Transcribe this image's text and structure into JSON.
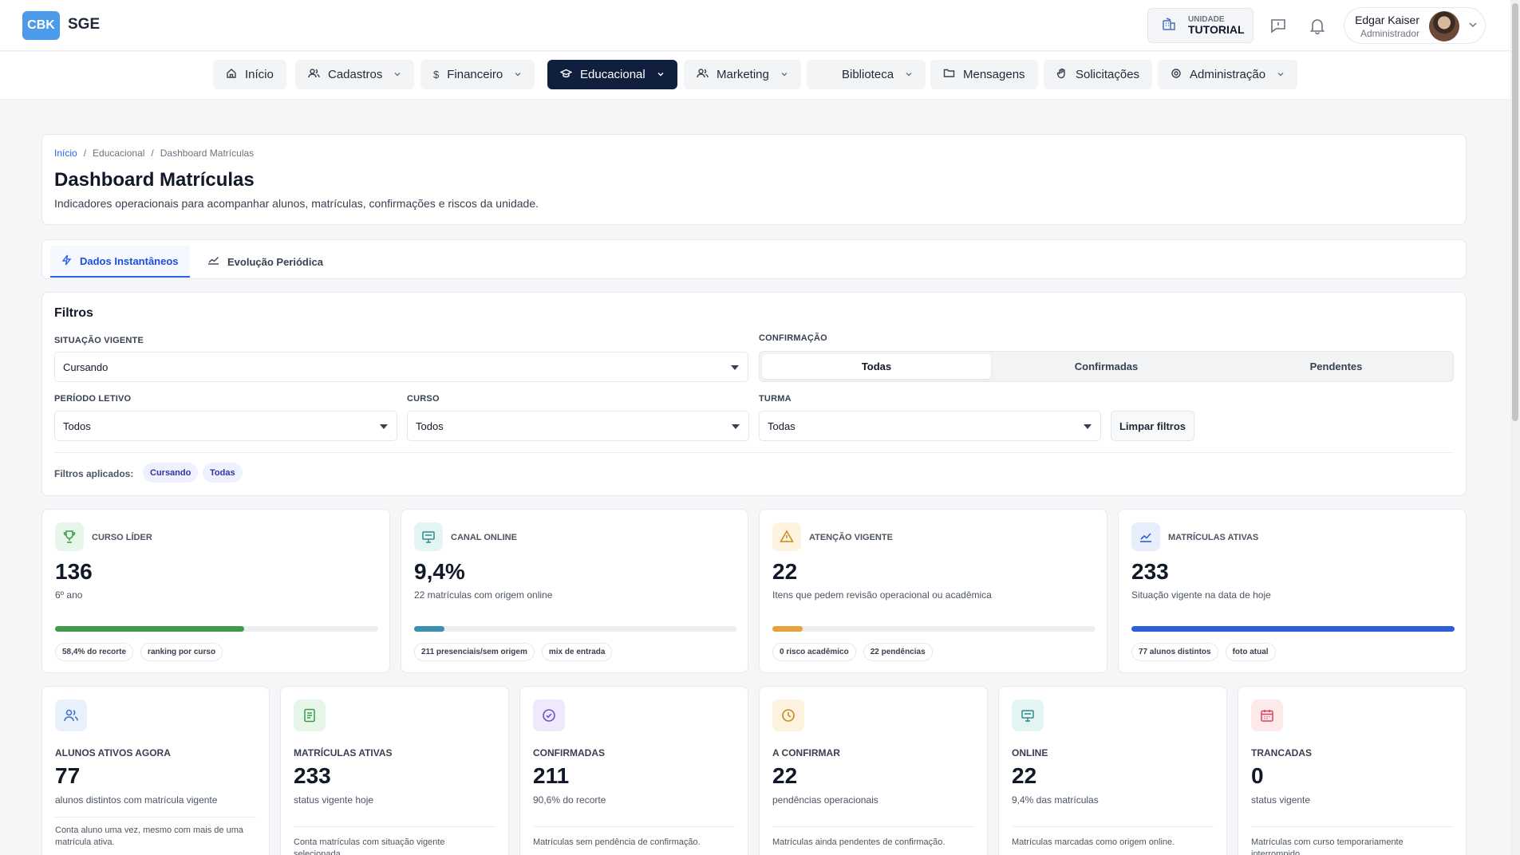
{
  "header": {
    "logo": "CBK",
    "app_name": "SGE",
    "unit_label": "UNIDADE",
    "unit_value": "TUTORIAL",
    "user_name": "Edgar Kaiser",
    "user_role": "Administrador"
  },
  "nav": {
    "items": [
      {
        "label": "Início",
        "icon": "home-icon"
      },
      {
        "label": "Cadastros",
        "icon": "users-icon"
      },
      {
        "label": "Financeiro",
        "icon": "dollar-icon"
      },
      {
        "label": "Educacional",
        "icon": "graduation-cap-icon",
        "active": true
      },
      {
        "label": "Marketing",
        "icon": "users-icon"
      },
      {
        "label": "Biblioteca",
        "icon": ""
      },
      {
        "label": "Mensagens",
        "icon": "folder-icon"
      },
      {
        "label": "Solicitações",
        "icon": "hand-icon"
      },
      {
        "label": "Administração",
        "icon": "settings-icon"
      }
    ]
  },
  "page": {
    "breadcrumb": [
      "Início",
      "Educacional",
      "Dashboard Matrículas"
    ],
    "title": "Dashboard Matrículas",
    "subtitle": "Indicadores operacionais para acompanhar alunos, matrículas, confirmações e riscos da unidade."
  },
  "tabs": [
    {
      "label": "Dados Instantâneos",
      "active": true
    },
    {
      "label": "Evolução Periódica"
    }
  ],
  "filters": {
    "title": "Filtros",
    "situacao_label": "SITUAÇÃO VIGENTE",
    "situacao_value": "Cursando",
    "confirmacao_label": "CONFIRMAÇÃO",
    "confirmacao_options": [
      "Todas",
      "Confirmadas",
      "Pendentes"
    ],
    "confirmacao_selected": "Todas",
    "periodo_label": "PERÍODO LETIVO",
    "periodo_value": "Todos",
    "curso_label": "CURSO",
    "curso_value": "Todos",
    "turma_label": "TURMA",
    "turma_value": "Todas",
    "clear_label": "Limpar filtros",
    "applied_label": "Filtros aplicados:",
    "applied_chips": [
      "Cursando",
      "Todas"
    ]
  },
  "kpis": [
    {
      "label": "CURSO LÍDER",
      "value": "136",
      "sub": "6º ano",
      "progress": 0.584,
      "color": "#3f9b49",
      "icon_bg": "#e7f6ea",
      "icon": "trophy-icon",
      "tags": [
        "58,4% do recorte",
        "ranking por curso"
      ]
    },
    {
      "label": "CANAL ONLINE",
      "value": "9,4%",
      "sub": "22 matrículas com origem online",
      "progress": 0.094,
      "color": "#3b8fb0",
      "icon_bg": "#e3f5f3",
      "icon": "monitor-icon",
      "tags": [
        "211 presenciais/sem origem",
        "mix de entrada"
      ]
    },
    {
      "label": "ATENÇÃO VIGENTE",
      "value": "22",
      "sub": "Itens que pedem revisão operacional ou acadêmica",
      "progress": 0.094,
      "color": "#e9a23b",
      "icon_bg": "#fdf3de",
      "icon": "warning-icon",
      "tags": [
        "0 risco acadêmico",
        "22 pendências"
      ]
    },
    {
      "label": "MATRÍCULAS ATIVAS",
      "value": "233",
      "sub": "Situação vigente na data de hoje",
      "progress": 1.0,
      "color": "#2d5fd8",
      "icon_bg": "#e8eefc",
      "icon": "trend-up-icon",
      "tags": [
        "77 alunos distintos",
        "foto atual"
      ]
    }
  ],
  "stats": [
    {
      "label": "ALUNOS ATIVOS AGORA",
      "value": "77",
      "sub": "alunos distintos com matrícula vigente",
      "note": "Conta aluno uma vez, mesmo com mais de uma matrícula ativa.",
      "icon": "users-icon",
      "icon_bg": "#e8f0fb"
    },
    {
      "label": "MATRÍCULAS ATIVAS",
      "value": "233",
      "sub": "status vigente hoje",
      "note": "Conta matrículas com situação vigente selecionada.",
      "icon": "document-icon",
      "icon_bg": "#e6f6e9"
    },
    {
      "label": "CONFIRMADAS",
      "value": "211",
      "sub": "90,6% do recorte",
      "note": "Matrículas sem pendência de confirmação.",
      "icon": "check-circle-icon",
      "icon_bg": "#eee9fb"
    },
    {
      "label": "A CONFIRMAR",
      "value": "22",
      "sub": "pendências operacionais",
      "note": "Matrículas ainda pendentes de confirmação.",
      "icon": "clock-icon",
      "icon_bg": "#fdf3de"
    },
    {
      "label": "ONLINE",
      "value": "22",
      "sub": "9,4% das matrículas",
      "note": "Matrículas marcadas como origem online.",
      "icon": "monitor-icon",
      "icon_bg": "#e3f5f3"
    },
    {
      "label": "TRANCADAS",
      "value": "0",
      "sub": "status vigente",
      "note": "Matrículas com curso temporariamente interrompido.",
      "icon": "calendar-icon",
      "icon_bg": "#fde8ea"
    }
  ]
}
